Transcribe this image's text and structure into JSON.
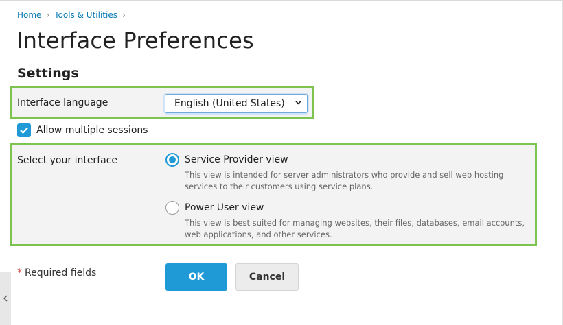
{
  "breadcrumb": {
    "items": [
      "Home",
      "Tools & Utilities"
    ]
  },
  "page": {
    "title": "Interface Preferences",
    "section_title": "Settings"
  },
  "language": {
    "label": "Interface language",
    "selected": "English (United States)"
  },
  "sessions": {
    "label": "Allow multiple sessions",
    "checked": true
  },
  "interface": {
    "label": "Select your interface",
    "options": [
      {
        "title": "Service Provider view",
        "description": "This view is intended for server administrators who provide and sell web hosting services to their customers using service plans.",
        "selected": true
      },
      {
        "title": "Power User view",
        "description": "This view is best suited for managing websites, their files, databases, email accounts, web applications, and other services.",
        "selected": false
      }
    ]
  },
  "footer": {
    "required_text": "Required fields",
    "required_marker": "*",
    "ok_label": "OK",
    "cancel_label": "Cancel"
  },
  "colors": {
    "accent": "#1f9ad6",
    "highlight": "#7cc44f",
    "link": "#0a7bb5",
    "required": "#d9534f"
  }
}
